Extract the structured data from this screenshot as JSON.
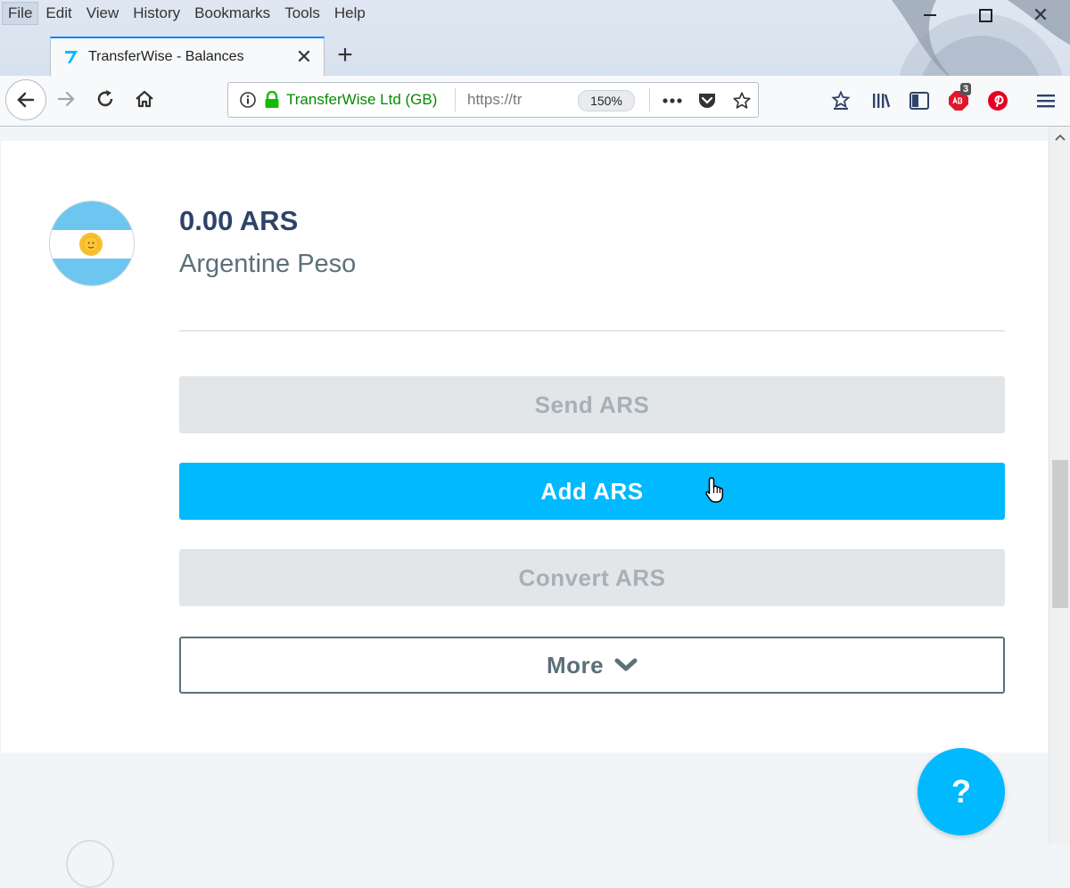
{
  "menu": {
    "file": "File",
    "edit": "Edit",
    "view": "View",
    "history": "History",
    "bookmarks": "Bookmarks",
    "tools": "Tools",
    "help": "Help"
  },
  "tab": {
    "title": "TransferWise - Balances"
  },
  "urlbar": {
    "identity": "TransferWise Ltd (GB)",
    "url": "https://tr",
    "zoom": "150%"
  },
  "toolbar": {
    "adblock_badge": "3"
  },
  "balance": {
    "amount": "0.00 ARS",
    "currency_name": "Argentine Peso"
  },
  "actions": {
    "send": "Send ARS",
    "add": "Add ARS",
    "convert": "Convert ARS",
    "more": "More"
  },
  "help_button": {
    "label": "?"
  },
  "colors": {
    "primary": "#00b9ff",
    "heading": "#2e4369",
    "muted": "#5d7079",
    "disabled_bg": "#e2e6e8",
    "secure_green": "#058b00"
  },
  "icons": {
    "flag": "argentina-flag-icon",
    "back": "back-arrow-icon",
    "forward": "forward-arrow-icon",
    "reload": "reload-icon",
    "home": "home-icon",
    "info": "info-icon",
    "lock": "lock-icon",
    "page_actions": "ellipsis-icon",
    "pocket": "pocket-icon",
    "bookmark_star": "star-icon",
    "chevron": "chevron-down-icon",
    "cursor": "hand-pointer-icon"
  }
}
